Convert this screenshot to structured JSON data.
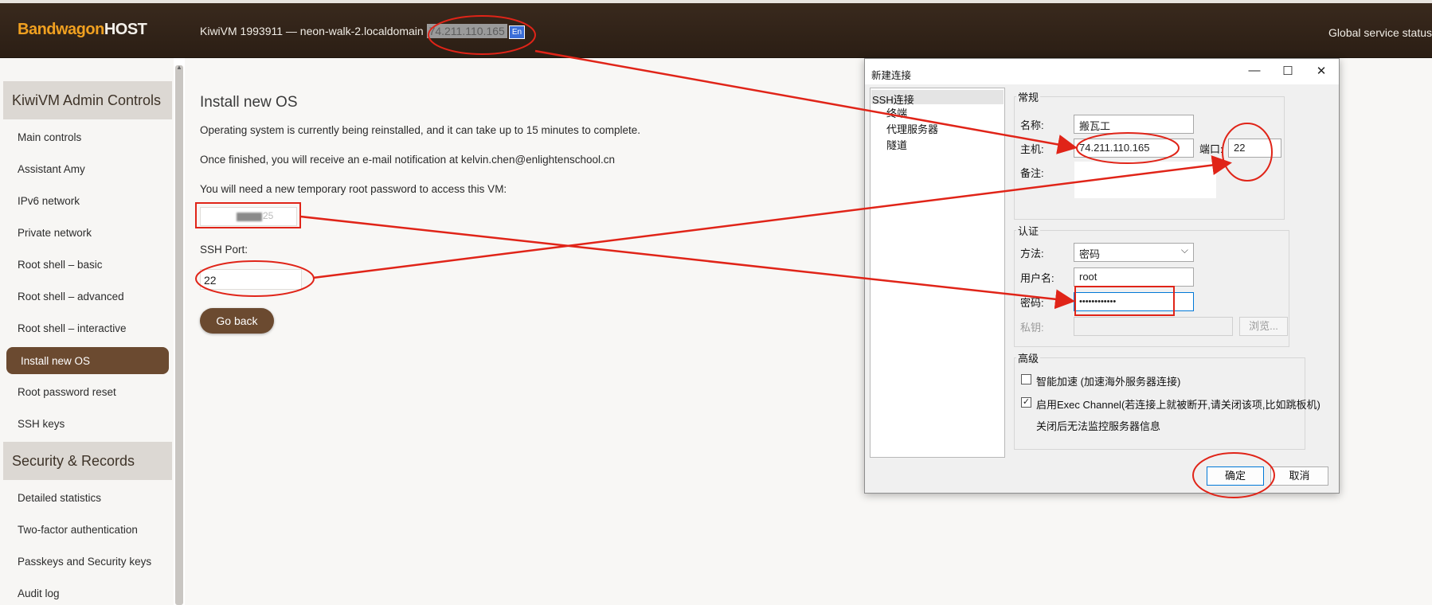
{
  "topbar": {
    "logo_part1": "Bandwagon",
    "logo_part2": "HOST",
    "vm_title": "KiwiVM 1993911 — neon-walk-2.localdomain",
    "vm_ip": "74.211.110.165",
    "ime_label": "En",
    "global_status": "Global service status"
  },
  "sidebar": {
    "section1": "KiwiVM Admin Controls",
    "items1": [
      "Main controls",
      "Assistant Amy",
      "IPv6 network",
      "Private network",
      "Root shell – basic",
      "Root shell – advanced",
      "Root shell – interactive"
    ],
    "active": "Install new OS",
    "items2": [
      "Root password reset",
      "SSH keys"
    ],
    "section2": "Security & Records",
    "items3": [
      "Detailed statistics",
      "Two-factor authentication",
      "Passkeys and Security keys",
      "Audit log"
    ]
  },
  "main": {
    "title": "Install new OS",
    "line1": "Operating system is currently being reinstalled, and it can take up to 15 minutes to complete.",
    "line2": "Once finished, you will receive an e-mail notification at kelvin.chen@enlightenschool.cn",
    "line3": "You will need a new temporary root password to access this VM:",
    "password_fragment": "25",
    "ssh_port_label": "SSH Port:",
    "ssh_port_value": "22",
    "go_back": "Go back"
  },
  "dialog": {
    "title": "新建连接",
    "tree": [
      "SSH连接",
      "终端",
      "代理服务器",
      "隧道"
    ],
    "general": {
      "group": "常规",
      "name_label": "名称:",
      "name_value": "搬瓦工",
      "host_label": "主机:",
      "host_value": "74.211.110.165",
      "port_label": "端口:",
      "port_value": "22",
      "note_label": "备注:"
    },
    "auth": {
      "group": "认证",
      "method_label": "方法:",
      "method_value": "密码",
      "user_label": "用户名:",
      "user_value": "root",
      "pass_label": "密码:",
      "pass_value": "••••••••••••",
      "key_label": "私钥:",
      "browse": "浏览..."
    },
    "advanced": {
      "group": "高级",
      "smart_accel": "智能加速 (加速海外服务器连接)",
      "smart_accel_checked": false,
      "exec_channel": "启用Exec Channel(若连接上就被断开,请关闭该项,比如跳板机)",
      "exec_channel_checked": true,
      "exec_note": "关闭后无法监控服务器信息"
    },
    "ok": "确定",
    "cancel": "取消"
  },
  "colors": {
    "brand_brown": "#6b4a30",
    "topbar": "#2b1e14",
    "logo_orange": "#f0a020",
    "annotation_red": "#e02418"
  }
}
